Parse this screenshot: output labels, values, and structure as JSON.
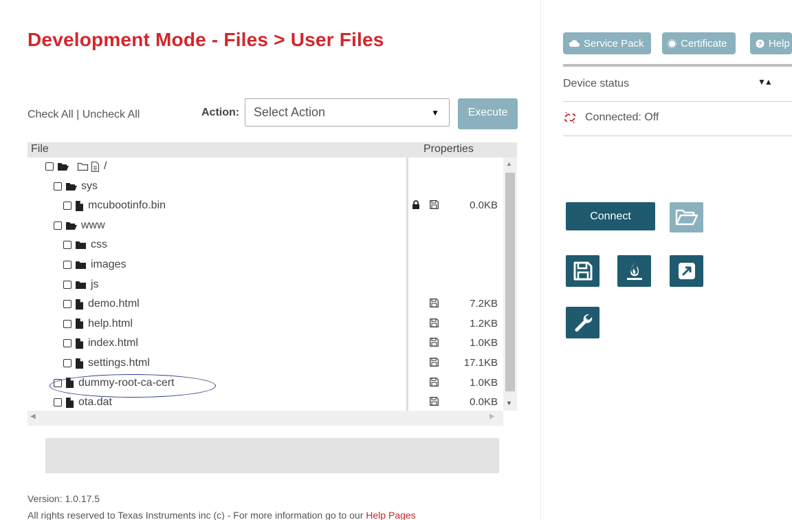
{
  "page": {
    "title": "Development Mode - Files > User Files"
  },
  "toolbar": {
    "check_all": "Check All",
    "separator": " | ",
    "uncheck_all": "Uncheck All",
    "action_label": "Action:",
    "action_value": "Select Action",
    "execute_label": "Execute"
  },
  "table": {
    "col_file": "File",
    "col_properties": "Properties"
  },
  "tree": [
    {
      "name": "/",
      "kind": "root",
      "locked": false,
      "has_floppy": false,
      "size": ""
    },
    {
      "name": "sys",
      "kind": "folder-open",
      "locked": false,
      "has_floppy": false,
      "size": ""
    },
    {
      "name": "mcubootinfo.bin",
      "kind": "file",
      "locked": true,
      "has_floppy": true,
      "size": "0.0KB"
    },
    {
      "name": "www",
      "kind": "folder-open",
      "locked": false,
      "has_floppy": false,
      "size": ""
    },
    {
      "name": "css",
      "kind": "folder",
      "locked": false,
      "has_floppy": false,
      "size": ""
    },
    {
      "name": "images",
      "kind": "folder",
      "locked": false,
      "has_floppy": false,
      "size": ""
    },
    {
      "name": "js",
      "kind": "folder",
      "locked": false,
      "has_floppy": false,
      "size": ""
    },
    {
      "name": "demo.html",
      "kind": "file",
      "locked": false,
      "has_floppy": true,
      "size": "7.2KB"
    },
    {
      "name": "help.html",
      "kind": "file",
      "locked": false,
      "has_floppy": true,
      "size": "1.2KB"
    },
    {
      "name": "index.html",
      "kind": "file",
      "locked": false,
      "has_floppy": true,
      "size": "1.0KB"
    },
    {
      "name": "settings.html",
      "kind": "file",
      "locked": false,
      "has_floppy": true,
      "size": "17.1KB"
    },
    {
      "name": "dummy-root-ca-cert",
      "kind": "file",
      "locked": false,
      "has_floppy": true,
      "size": "1.0KB"
    },
    {
      "name": "ota.dat",
      "kind": "file",
      "locked": false,
      "has_floppy": true,
      "size": "0.0KB"
    }
  ],
  "footer": {
    "version": "Version: 1.0.17.5",
    "rights": "All rights reserved to Texas Instruments inc (c) - For more information go to our ",
    "help_link": "Help Pages"
  },
  "sidebar": {
    "service_pack": "Service Pack",
    "certificate": "Certificate",
    "help": "Help",
    "device_status": "Device status",
    "connection": "Connected: Off",
    "connect_button": "Connect"
  },
  "colors": {
    "title_red": "#d3262c",
    "accent_light": "#8ab1bd",
    "accent_dark": "#1f5a6e",
    "link_red": "#c0262b"
  },
  "icons": {
    "open_folder": "folder-open-icon",
    "folder": "folder-icon",
    "file": "file-icon",
    "lock": "lock-icon",
    "floppy": "floppy-disk-icon",
    "cloud": "cloud-icon",
    "certificate": "badge-icon",
    "help": "question-circle-icon",
    "unlink": "unlink-icon",
    "save": "save-icon",
    "flame": "flame-icon",
    "external": "external-link-icon",
    "wrench": "wrench-icon"
  }
}
